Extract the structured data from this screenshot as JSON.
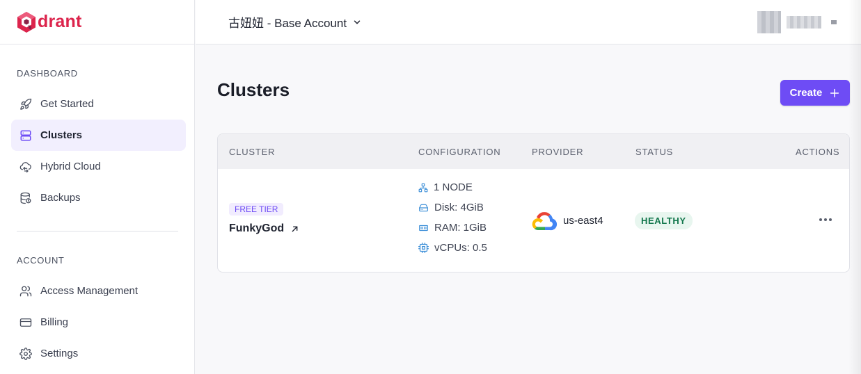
{
  "brand": {
    "logo_text": "drant",
    "color": "#dc244c"
  },
  "header": {
    "account_label": "古妞妞 - Base Account"
  },
  "sidebar": {
    "dashboard_label": "DASHBOARD",
    "account_label": "ACCOUNT",
    "items": [
      {
        "label": "Get Started",
        "icon": "rocket-icon"
      },
      {
        "label": "Clusters",
        "icon": "server-icon",
        "active": true
      },
      {
        "label": "Hybrid Cloud",
        "icon": "cloud-sync-icon"
      },
      {
        "label": "Backups",
        "icon": "database-backup-icon"
      },
      {
        "label": "Access Management",
        "icon": "users-icon"
      },
      {
        "label": "Billing",
        "icon": "credit-card-icon"
      },
      {
        "label": "Settings",
        "icon": "gear-icon"
      }
    ]
  },
  "main": {
    "title": "Clusters",
    "create_label": "Create",
    "accent": "#6e4cf5",
    "table": {
      "headers": [
        "CLUSTER",
        "CONFIGURATION",
        "PROVIDER",
        "STATUS",
        "ACTIONS"
      ],
      "rows": [
        {
          "tier": "FREE TIER",
          "name": "FunkyGod",
          "config": {
            "nodes": "1 NODE",
            "disk": "Disk: 4GiB",
            "ram": "RAM: 1GiB",
            "vcpus": "vCPUs: 0.5"
          },
          "provider": {
            "region": "us-east4",
            "icon": "google-cloud-icon"
          },
          "status": "HEALTHY"
        }
      ]
    }
  }
}
